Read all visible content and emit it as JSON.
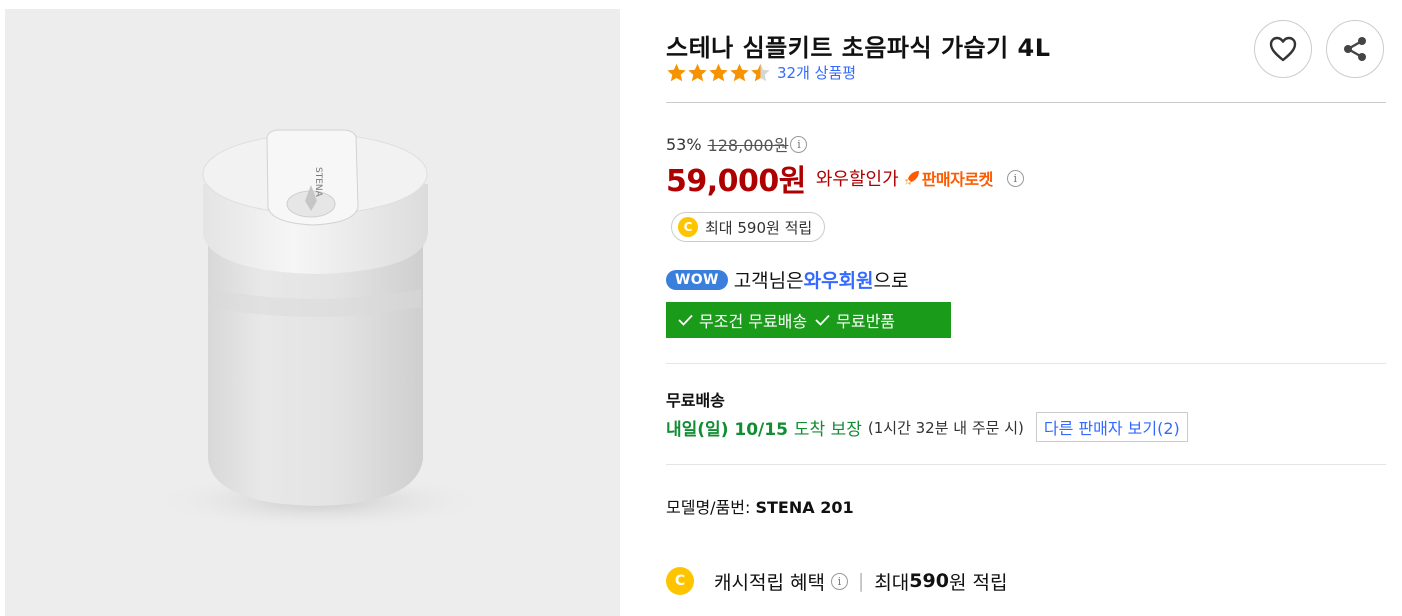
{
  "product": {
    "title": "스테나 심플키트 초음파식 가습기 4L",
    "rating": 4.5,
    "review_count_label": "32개 상품평",
    "image": {
      "brand_text": "STENA"
    }
  },
  "actions": {
    "wishlist_icon": "heart-icon",
    "share_icon": "share-icon"
  },
  "price": {
    "discount_rate": "53%",
    "original": "128,000원",
    "info_glyph": "i",
    "sale": "59,000원",
    "sale_label": "와우할인가",
    "badge_label": "판매자로켓",
    "cash_pill": "최대 590원 적립",
    "coin_glyph": "C"
  },
  "wow": {
    "badge": "WOW",
    "text_before": "고객님은 ",
    "member": "와우회원",
    "text_after": "으로",
    "benefit_1": "무조건 무료배송",
    "benefit_2": "무료반품"
  },
  "shipping": {
    "title": "무료배송",
    "date": "내일(일) 10/15",
    "guarantee": "도착 보장",
    "cutoff": "(1시간 32분 내 주문 시)",
    "other_sellers": "다른 판매자 보기(2)"
  },
  "model": {
    "label": "모델명/품번:",
    "value": "STENA 201"
  },
  "cashback": {
    "label": "캐시적립 혜택",
    "max_prefix": "최대 ",
    "amount": "590",
    "suffix": "원 적립"
  },
  "colors": {
    "price_red": "#ae0000",
    "link_blue": "#346aff",
    "delivery_green": "#118e33",
    "star_orange": "#f79200"
  }
}
